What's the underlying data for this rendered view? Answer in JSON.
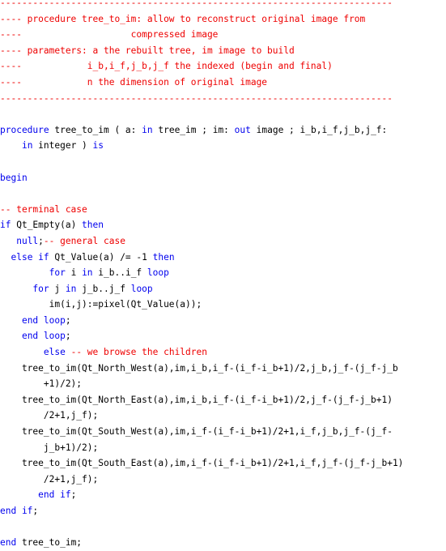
{
  "document": {
    "title": "procedure tree_to_im",
    "language": "Ada",
    "colors": {
      "keyword": "#0000ee",
      "comment": "#ee0000",
      "text": "#000000",
      "background": "#ffffff"
    },
    "lines": [
      [
        {
          "t": "cm",
          "v": "------------------------------------------------------------------------"
        }
      ],
      [
        {
          "t": "cm",
          "v": "---- procedure tree_to_im: allow to reconstruct original image from"
        }
      ],
      [
        {
          "t": "cm",
          "v": "----                    compressed image"
        }
      ],
      [
        {
          "t": "cm",
          "v": "---- parameters: a the rebuilt tree, im image to build"
        }
      ],
      [
        {
          "t": "cm",
          "v": "----            i_b,i_f,j_b,j_f the indexed (begin and final)"
        }
      ],
      [
        {
          "t": "cm",
          "v": "----            n the dimension of original image"
        }
      ],
      [
        {
          "t": "cm",
          "v": "------------------------------------------------------------------------"
        }
      ],
      [],
      [
        {
          "t": "kw",
          "v": "procedure"
        },
        {
          "t": "tx",
          "v": " tree_to_im ( a: "
        },
        {
          "t": "kw",
          "v": "in"
        },
        {
          "t": "tx",
          "v": " tree_im ; im: "
        },
        {
          "t": "kw",
          "v": "out"
        },
        {
          "t": "tx",
          "v": " image ; i_b,i_f,j_b,j_f:"
        }
      ],
      [
        {
          "t": "tx",
          "v": "    "
        },
        {
          "t": "kw",
          "v": "in"
        },
        {
          "t": "tx",
          "v": " integer ) "
        },
        {
          "t": "kw",
          "v": "is"
        }
      ],
      [],
      [
        {
          "t": "kw",
          "v": "begin"
        }
      ],
      [],
      [
        {
          "t": "cm",
          "v": "-- terminal case"
        }
      ],
      [
        {
          "t": "kw",
          "v": "if"
        },
        {
          "t": "tx",
          "v": " Qt_Empty(a) "
        },
        {
          "t": "kw",
          "v": "then"
        }
      ],
      [
        {
          "t": "tx",
          "v": "   "
        },
        {
          "t": "kw",
          "v": "null"
        },
        {
          "t": "tx",
          "v": ";"
        },
        {
          "t": "cm",
          "v": "-- general case"
        }
      ],
      [
        {
          "t": "tx",
          "v": "  "
        },
        {
          "t": "kw",
          "v": "else if"
        },
        {
          "t": "tx",
          "v": " Qt_Value(a) /= -1 "
        },
        {
          "t": "kw",
          "v": "then"
        }
      ],
      [
        {
          "t": "tx",
          "v": "         "
        },
        {
          "t": "kw",
          "v": "for"
        },
        {
          "t": "tx",
          "v": " i "
        },
        {
          "t": "kw",
          "v": "in"
        },
        {
          "t": "tx",
          "v": " i_b..i_f "
        },
        {
          "t": "kw",
          "v": "loop"
        }
      ],
      [
        {
          "t": "tx",
          "v": "      "
        },
        {
          "t": "kw",
          "v": "for"
        },
        {
          "t": "tx",
          "v": " j "
        },
        {
          "t": "kw",
          "v": "in"
        },
        {
          "t": "tx",
          "v": " j_b..j_f "
        },
        {
          "t": "kw",
          "v": "loop"
        }
      ],
      [
        {
          "t": "tx",
          "v": "         im(i,j):=pixel(Qt_Value(a));"
        }
      ],
      [
        {
          "t": "tx",
          "v": "    "
        },
        {
          "t": "kw",
          "v": "end loop"
        },
        {
          "t": "tx",
          "v": ";"
        }
      ],
      [
        {
          "t": "tx",
          "v": "    "
        },
        {
          "t": "kw",
          "v": "end loop"
        },
        {
          "t": "tx",
          "v": ";"
        }
      ],
      [
        {
          "t": "tx",
          "v": "        "
        },
        {
          "t": "kw",
          "v": "else"
        },
        {
          "t": "tx",
          "v": " "
        },
        {
          "t": "cm",
          "v": "-- we browse the children"
        }
      ],
      [
        {
          "t": "tx",
          "v": "    tree_to_im(Qt_North_West(a),im,i_b,i_f-(i_f-i_b+1)/2,j_b,j_f-(j_f-j_b"
        }
      ],
      [
        {
          "t": "tx",
          "v": "        +1)/2);"
        }
      ],
      [
        {
          "t": "tx",
          "v": "    tree_to_im(Qt_North_East(a),im,i_b,i_f-(i_f-i_b+1)/2,j_f-(j_f-j_b+1)"
        }
      ],
      [
        {
          "t": "tx",
          "v": "        /2+1,j_f);"
        }
      ],
      [
        {
          "t": "tx",
          "v": "    tree_to_im(Qt_South_West(a),im,i_f-(i_f-i_b+1)/2+1,i_f,j_b,j_f-(j_f-"
        }
      ],
      [
        {
          "t": "tx",
          "v": "        j_b+1)/2);"
        }
      ],
      [
        {
          "t": "tx",
          "v": "    tree_to_im(Qt_South_East(a),im,i_f-(i_f-i_b+1)/2+1,i_f,j_f-(j_f-j_b+1)"
        }
      ],
      [
        {
          "t": "tx",
          "v": "        /2+1,j_f);"
        }
      ],
      [
        {
          "t": "tx",
          "v": "       "
        },
        {
          "t": "kw",
          "v": "end if"
        },
        {
          "t": "tx",
          "v": ";"
        }
      ],
      [
        {
          "t": "kw",
          "v": "end if"
        },
        {
          "t": "tx",
          "v": ";"
        }
      ],
      [],
      [
        {
          "t": "kw",
          "v": "end"
        },
        {
          "t": "tx",
          "v": " tree_to_im;"
        }
      ]
    ]
  }
}
